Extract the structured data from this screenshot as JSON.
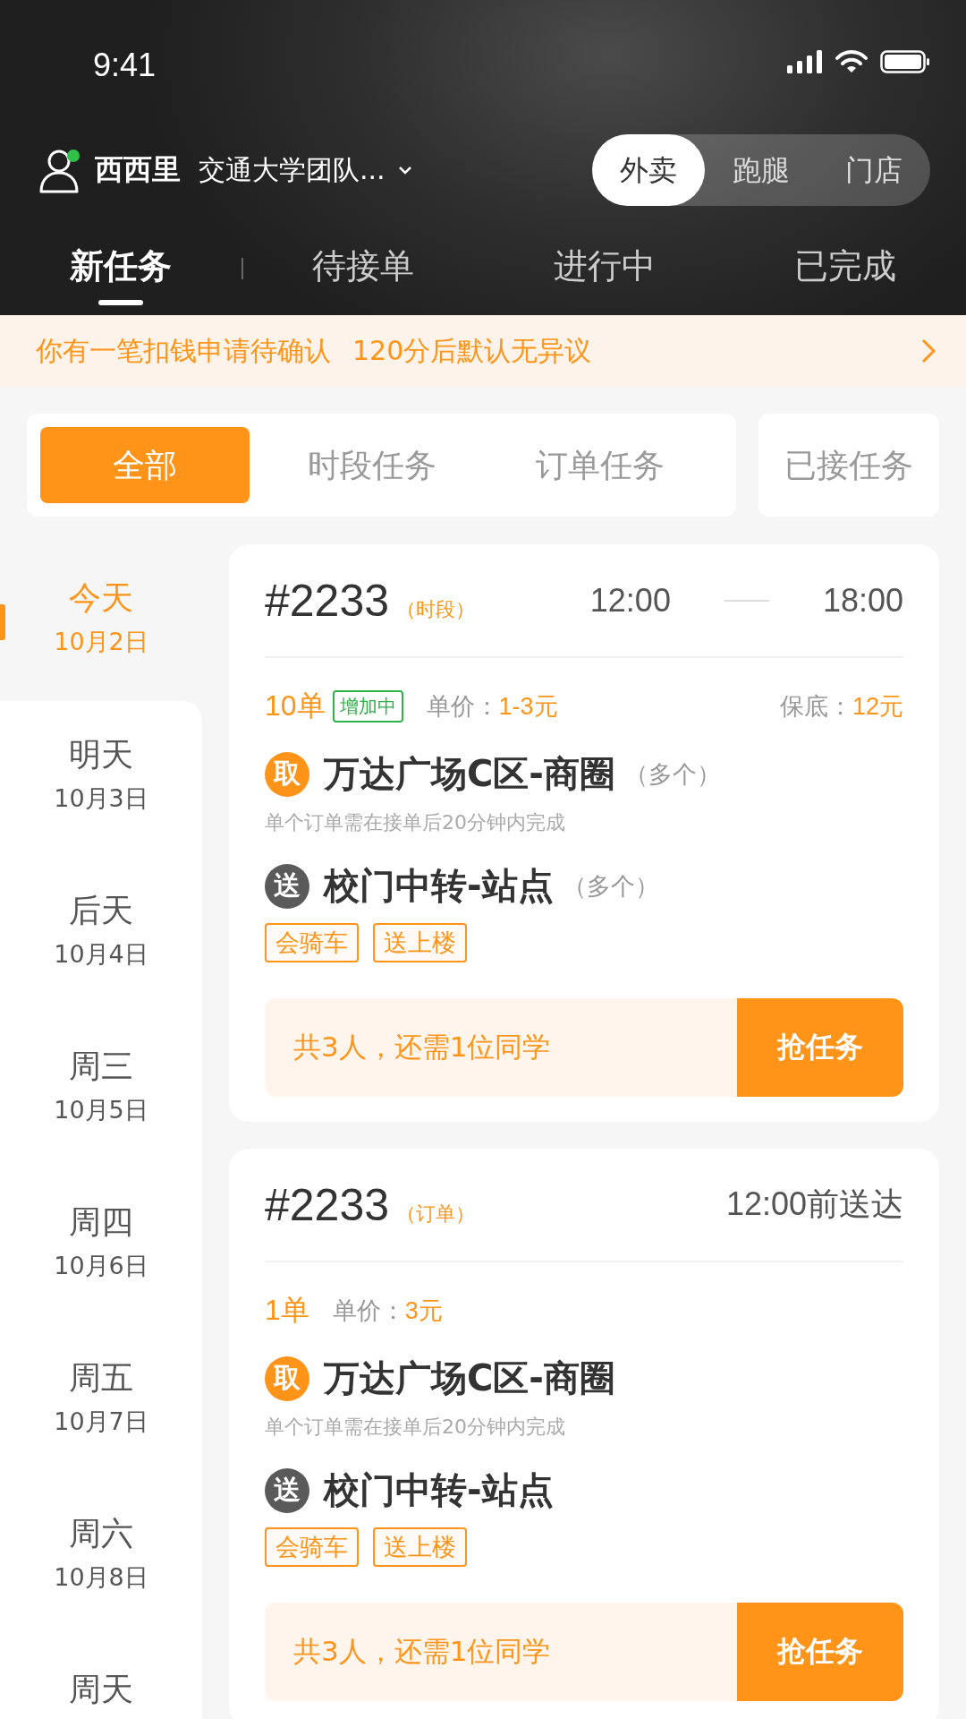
{
  "status_bar": {
    "time": "9:41"
  },
  "account": {
    "name": "西西里",
    "team": "交通大学团队...",
    "online": true
  },
  "mode_switch": [
    {
      "label": "外卖",
      "selected": true
    },
    {
      "label": "跑腿",
      "selected": false
    },
    {
      "label": "门店",
      "selected": false
    }
  ],
  "tabs": [
    {
      "label": "新任务",
      "selected": true
    },
    {
      "label": "待接单",
      "selected": false
    },
    {
      "label": "进行中",
      "selected": false
    },
    {
      "label": "已完成",
      "selected": false
    }
  ],
  "notice": {
    "text": "你有一笔扣钱申请待确认",
    "detail": "120分后默认无异议"
  },
  "filters": [
    {
      "label": "全部",
      "selected": true
    },
    {
      "label": "时段任务",
      "selected": false
    },
    {
      "label": "订单任务",
      "selected": false
    }
  ],
  "accepted_filter": {
    "label": "已接任务",
    "selected": false
  },
  "days": [
    {
      "day": "今天",
      "date": "10月2日",
      "selected": true
    },
    {
      "day": "明天",
      "date": "10月3日",
      "selected": false
    },
    {
      "day": "后天",
      "date": "10月4日",
      "selected": false
    },
    {
      "day": "周三",
      "date": "10月5日",
      "selected": false
    },
    {
      "day": "周四",
      "date": "10月6日",
      "selected": false
    },
    {
      "day": "周五",
      "date": "10月7日",
      "selected": false
    },
    {
      "day": "周六",
      "date": "10月8日",
      "selected": false
    },
    {
      "day": "周天",
      "selected": false
    }
  ],
  "tasks": [
    {
      "kind": "slot",
      "number": "#2233",
      "type_label": "（时段）",
      "start": "12:00",
      "end": "18:00",
      "orders": "10单",
      "badge": "增加中",
      "price_label": "单价：",
      "price": "1-3元",
      "guarantee_label": "保底：",
      "guarantee": "12元",
      "pickup": {
        "mark": "取",
        "place": "万达广场C区-商圈",
        "count": "（多个）"
      },
      "note": "单个订单需在接单后20分钟内完成",
      "dropoff": {
        "mark": "送",
        "place": "校门中转-站点",
        "count": "（多个）"
      },
      "tags": [
        "会骑车",
        "送上楼"
      ],
      "people": "共3人，还需1位同学",
      "action": "抢任务"
    },
    {
      "kind": "order",
      "number": "#2233",
      "type_label": "（订单）",
      "deadline": "12:00前送达",
      "orders": "1单",
      "price_label": "单价：",
      "price": "3元",
      "pickup": {
        "mark": "取",
        "place": "万达广场C区-商圈"
      },
      "note": "单个订单需在接单后20分钟内完成",
      "dropoff": {
        "mark": "送",
        "place": "校门中转-站点"
      },
      "tags": [
        "会骑车",
        "送上楼"
      ],
      "people": "共3人，还需1位同学",
      "action": "抢任务"
    }
  ]
}
